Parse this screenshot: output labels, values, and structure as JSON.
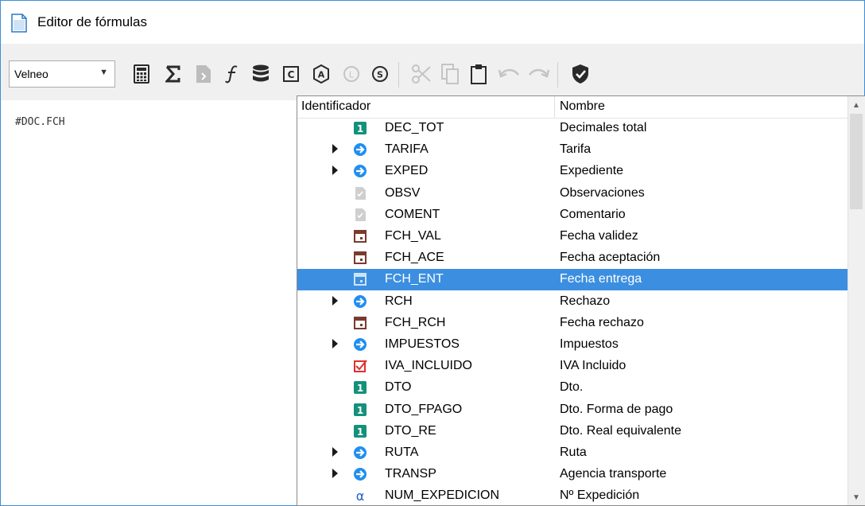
{
  "window": {
    "title": "Editor de fórmulas",
    "accent": "#3c8ed8"
  },
  "toolbar": {
    "combo_value": "Velneo",
    "buttons": [
      {
        "name": "calculator-icon",
        "enabled": true
      },
      {
        "name": "sigma-icon",
        "enabled": true
      },
      {
        "name": "document-icon",
        "enabled": false
      },
      {
        "name": "function-icon",
        "enabled": true
      },
      {
        "name": "database-icon",
        "enabled": true
      },
      {
        "name": "c-box-icon",
        "enabled": true
      },
      {
        "name": "a-hexagon-icon",
        "enabled": true
      },
      {
        "name": "l-circle-icon",
        "enabled": false
      },
      {
        "name": "s-circle-icon",
        "enabled": true
      },
      {
        "name": "cut-icon",
        "enabled": false
      },
      {
        "name": "copy-icon",
        "enabled": false
      },
      {
        "name": "paste-icon",
        "enabled": true
      },
      {
        "name": "undo-icon",
        "enabled": false
      },
      {
        "name": "redo-icon",
        "enabled": false
      },
      {
        "name": "shield-check-icon",
        "enabled": true
      }
    ]
  },
  "editor": {
    "content": "#DOC.FCH"
  },
  "popup": {
    "columns": [
      "Identificador",
      "Nombre"
    ],
    "selected_color": "#3c8fe0",
    "rows": [
      {
        "id": "DEC_TOT",
        "name": "Decimales total",
        "icon": "numeric-field-icon",
        "expandable": false
      },
      {
        "id": "TARIFA",
        "name": "Tarifa",
        "icon": "pointer-field-icon",
        "expandable": true
      },
      {
        "id": "EXPED",
        "name": "Expediente",
        "icon": "pointer-field-icon",
        "expandable": true
      },
      {
        "id": "OBSV",
        "name": "Observaciones",
        "icon": "formatted-text-icon",
        "expandable": false
      },
      {
        "id": "COMENT",
        "name": "Comentario",
        "icon": "formatted-text-icon",
        "expandable": false
      },
      {
        "id": "FCH_VAL",
        "name": "Fecha validez",
        "icon": "date-field-icon",
        "expandable": false
      },
      {
        "id": "FCH_ACE",
        "name": "Fecha aceptación",
        "icon": "date-field-icon",
        "expandable": false
      },
      {
        "id": "FCH_ENT",
        "name": "Fecha entrega",
        "icon": "date-field-icon",
        "expandable": false,
        "selected": true
      },
      {
        "id": "RCH",
        "name": "Rechazo",
        "icon": "pointer-field-icon",
        "expandable": true
      },
      {
        "id": "FCH_RCH",
        "name": "Fecha rechazo",
        "icon": "date-field-icon",
        "expandable": false
      },
      {
        "id": "IMPUESTOS",
        "name": "Impuestos",
        "icon": "pointer-field-icon",
        "expandable": true
      },
      {
        "id": "IVA_INCLUIDO",
        "name": "IVA Incluido",
        "icon": "boolean-field-icon",
        "expandable": false
      },
      {
        "id": "DTO",
        "name": "Dto.",
        "icon": "numeric-field-icon",
        "expandable": false
      },
      {
        "id": "DTO_FPAGO",
        "name": "Dto. Forma de pago",
        "icon": "numeric-field-icon",
        "expandable": false
      },
      {
        "id": "DTO_RE",
        "name": "Dto. Real equivalente",
        "icon": "numeric-field-icon",
        "expandable": false
      },
      {
        "id": "RUTA",
        "name": "Ruta",
        "icon": "pointer-field-icon",
        "expandable": true
      },
      {
        "id": "TRANSP",
        "name": "Agencia transporte",
        "icon": "pointer-field-icon",
        "expandable": true
      },
      {
        "id": "NUM_EXPEDICION",
        "name": "Nº Expedición",
        "icon": "alpha-field-icon",
        "expandable": false
      }
    ]
  }
}
